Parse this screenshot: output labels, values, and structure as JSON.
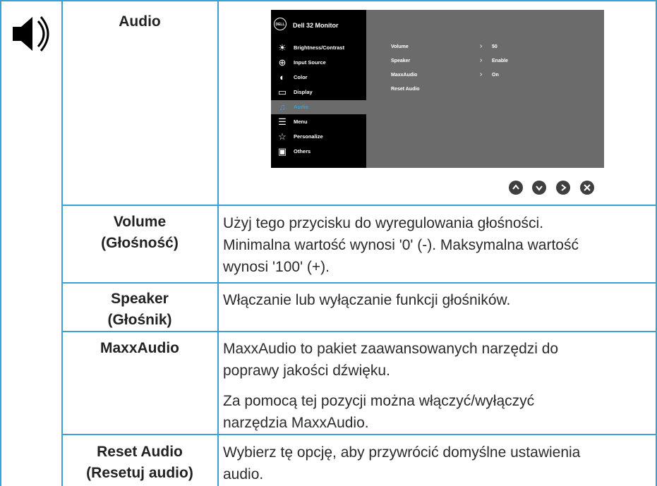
{
  "section": {
    "title": "Audio"
  },
  "osd": {
    "logo": "DELL",
    "title": "Dell 32 Monitor",
    "menu": [
      {
        "icon": "brightness-icon",
        "label": "Brightness/Contrast"
      },
      {
        "icon": "input-source-icon",
        "label": "Input Source"
      },
      {
        "icon": "color-icon",
        "label": "Color"
      },
      {
        "icon": "display-icon",
        "label": "Display"
      },
      {
        "icon": "audio-icon",
        "label": "Audio",
        "active": true
      },
      {
        "icon": "menu-icon",
        "label": "Menu"
      },
      {
        "icon": "personalize-icon",
        "label": "Personalize"
      },
      {
        "icon": "others-icon",
        "label": "Others"
      }
    ],
    "settings": [
      {
        "label": "Volume",
        "value": "50"
      },
      {
        "label": "Speaker",
        "value": "Enable"
      },
      {
        "label": "MaxxAudio",
        "value": "On"
      },
      {
        "label": "Reset Audio",
        "value": ""
      }
    ]
  },
  "nav_buttons": [
    "up-button-icon",
    "down-button-icon",
    "right-button-icon",
    "close-button-icon"
  ],
  "rows": [
    {
      "name": "Volume\n(Głośność)",
      "lines": [
        "Użyj tego przycisku do wyregulowania głośności.",
        "Minimalna wartość wynosi '0' (-). Maksymalna wartość",
        "wynosi '100' (+)."
      ]
    },
    {
      "name": "Speaker\n(Głośnik)",
      "lines": [
        "Włączanie lub wyłączanie funkcji głośników."
      ]
    },
    {
      "name": "MaxxAudio",
      "lines": [
        "MaxxAudio to pakiet zaawansowanych narzędzi do",
        "poprawy jakości dźwięku."
      ],
      "lines2": [
        "Za pomocą tej pozycji można włączyć/wyłączyć",
        "narzędzia MaxxAudio."
      ]
    },
    {
      "name": "Reset Audio\n(Resetuj audio)",
      "lines": [
        "Wybierz tę opcję, aby przywrócić domyślne ustawienia",
        "audio."
      ]
    }
  ],
  "colors": {
    "accent": "#3aa0d8",
    "osd_bg": "#6b6b6b",
    "osd_left": "#000000"
  }
}
